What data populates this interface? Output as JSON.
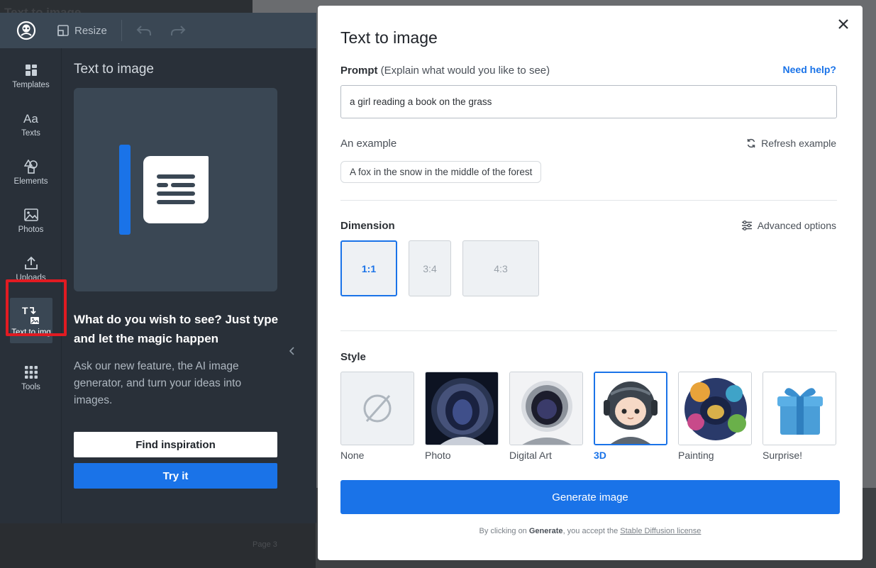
{
  "background": {
    "ghost_title": "Text to image",
    "page_label": "Page 3"
  },
  "topbar": {
    "resize_label": "Resize"
  },
  "sidenav": {
    "items": [
      {
        "label": "Templates",
        "icon": "templates-icon"
      },
      {
        "label": "Texts",
        "icon": "texts-icon"
      },
      {
        "label": "Elements",
        "icon": "elements-icon"
      },
      {
        "label": "Photos",
        "icon": "photos-icon"
      },
      {
        "label": "Uploads",
        "icon": "uploads-icon"
      },
      {
        "label": "Text to img",
        "icon": "text-to-img-icon",
        "active": true
      },
      {
        "label": "Tools",
        "icon": "tools-icon"
      }
    ]
  },
  "panel": {
    "title": "Text to image",
    "headline": "What do you wish to see? Just type and let the magic happen",
    "description": "Ask our new feature, the AI image generator, and turn your ideas into images.",
    "find_button": "Find inspiration",
    "try_button": "Try it"
  },
  "modal": {
    "title": "Text to image",
    "prompt_label": "Prompt",
    "prompt_hint": "(Explain what would you like to see)",
    "need_help": "Need help?",
    "prompt_value": "a girl reading a book on the grass",
    "example_label": "An example",
    "refresh_label": "Refresh example",
    "example_text": "A fox in the snow in the middle of the forest",
    "dimension_label": "Dimension",
    "advanced_label": "Advanced options",
    "dimensions": [
      {
        "label": "1:1",
        "selected": true
      },
      {
        "label": "3:4",
        "selected": false
      },
      {
        "label": "4:3",
        "selected": false
      }
    ],
    "style_label": "Style",
    "styles": [
      {
        "label": "None",
        "selected": false
      },
      {
        "label": "Photo",
        "selected": false
      },
      {
        "label": "Digital Art",
        "selected": false
      },
      {
        "label": "3D",
        "selected": true
      },
      {
        "label": "Painting",
        "selected": false
      },
      {
        "label": "Surprise!",
        "selected": false
      }
    ],
    "generate_label": "Generate image",
    "legal_prefix": "By clicking on ",
    "legal_bold": "Generate",
    "legal_middle": ", you accept the ",
    "legal_link": "Stable Diffusion license"
  },
  "colors": {
    "accent": "#1a73e8",
    "highlight": "#e11b22",
    "shell": "#293039",
    "topbar": "#3a4754"
  }
}
